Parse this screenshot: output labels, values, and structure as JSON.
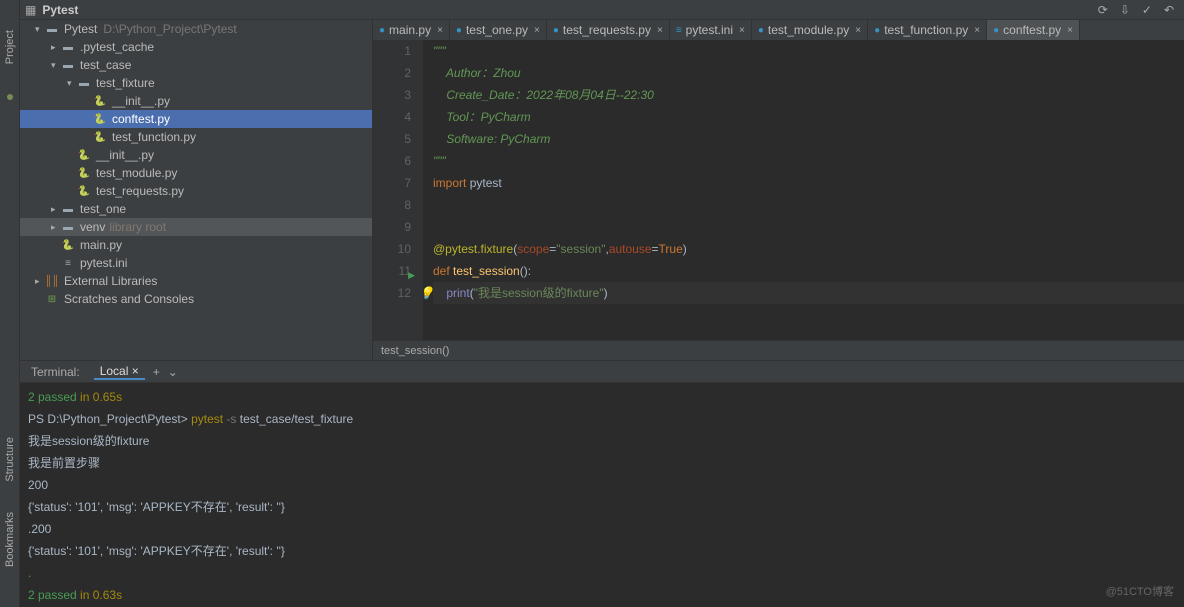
{
  "breadcrumb": {
    "project_name": "Pytest",
    "project_path": "D:\\Python_Project\\Pytest"
  },
  "rail": {
    "project": "Project",
    "structure": "Structure",
    "bookmarks": "Bookmarks"
  },
  "tree": [
    {
      "depth": 0,
      "chevron": "v",
      "icon": "folder-root",
      "label": "Pytest",
      "path": "D:\\Python_Project\\Pytest"
    },
    {
      "depth": 1,
      "chevron": ">",
      "icon": "folder",
      "label": ".pytest_cache"
    },
    {
      "depth": 1,
      "chevron": "v",
      "icon": "folder",
      "label": "test_case"
    },
    {
      "depth": 2,
      "chevron": "v",
      "icon": "folder",
      "label": "test_fixture"
    },
    {
      "depth": 3,
      "chevron": "",
      "icon": "py",
      "label": "__init__.py"
    },
    {
      "depth": 3,
      "chevron": "",
      "icon": "py",
      "label": "conftest.py",
      "selected": true
    },
    {
      "depth": 3,
      "chevron": "",
      "icon": "py",
      "label": "test_function.py"
    },
    {
      "depth": 2,
      "chevron": "",
      "icon": "py",
      "label": "__init__.py"
    },
    {
      "depth": 2,
      "chevron": "",
      "icon": "py",
      "label": "test_module.py"
    },
    {
      "depth": 2,
      "chevron": "",
      "icon": "py",
      "label": "test_requests.py"
    },
    {
      "depth": 1,
      "chevron": ">",
      "icon": "folder",
      "label": "test_one"
    },
    {
      "depth": 1,
      "chevron": ">",
      "icon": "folder",
      "label": "venv",
      "lib": "library root",
      "highlighted": true
    },
    {
      "depth": 1,
      "chevron": "",
      "icon": "py",
      "label": "main.py"
    },
    {
      "depth": 1,
      "chevron": "",
      "icon": "ini",
      "label": "pytest.ini"
    },
    {
      "depth": 0,
      "chevron": ">",
      "icon": "lib",
      "label": "External Libraries"
    },
    {
      "depth": 0,
      "chevron": "",
      "icon": "scratch",
      "label": "Scratches and Consoles"
    }
  ],
  "tabs": [
    {
      "label": "main.py",
      "icon": "py"
    },
    {
      "label": "test_one.py",
      "icon": "py"
    },
    {
      "label": "test_requests.py",
      "icon": "py"
    },
    {
      "label": "pytest.ini",
      "icon": "ini"
    },
    {
      "label": "test_module.py",
      "icon": "py"
    },
    {
      "label": "test_function.py",
      "icon": "py"
    },
    {
      "label": "conftest.py",
      "icon": "py",
      "active": true
    }
  ],
  "code": {
    "lines": [
      {
        "n": 1,
        "style": "comm",
        "text": "\"\"\""
      },
      {
        "n": 2,
        "style": "comm",
        "text": "    Author：Zhou"
      },
      {
        "n": 3,
        "style": "comm",
        "text": "    Create_Date：2022年08月04日--22:30"
      },
      {
        "n": 4,
        "style": "comm",
        "text": "    Tool：PyCharm"
      },
      {
        "n": 5,
        "style": "comm",
        "text": "    Software: PyCharm"
      },
      {
        "n": 6,
        "style": "comm",
        "text": "\"\"\""
      },
      {
        "n": 7,
        "segments": [
          [
            "kw",
            "import "
          ],
          [
            "id",
            "pytest"
          ]
        ]
      },
      {
        "n": 8,
        "text": ""
      },
      {
        "n": 9,
        "text": ""
      },
      {
        "n": 10,
        "segments": [
          [
            "deco",
            "@pytest.fixture"
          ],
          [
            "plain",
            "("
          ],
          [
            "param",
            "scope"
          ],
          [
            "plain",
            "="
          ],
          [
            "str",
            "\"session\""
          ],
          [
            "plain",
            ","
          ],
          [
            "param",
            "autouse"
          ],
          [
            "plain",
            "="
          ],
          [
            "bool",
            "True"
          ],
          [
            "plain",
            ")"
          ]
        ]
      },
      {
        "n": 11,
        "run": true,
        "segments": [
          [
            "kw",
            "def "
          ],
          [
            "fn",
            "test_session"
          ],
          [
            "plain",
            "():"
          ]
        ]
      },
      {
        "n": 12,
        "current": true,
        "bulb": true,
        "segments": [
          [
            "plain",
            "    "
          ],
          [
            "builtin",
            "print"
          ],
          [
            "plain",
            "("
          ],
          [
            "str",
            "\"我是session级的fixture\""
          ],
          [
            "plain",
            ")"
          ]
        ]
      }
    ],
    "breadcrumb": "test_session()"
  },
  "terminal": {
    "title": "Terminal:",
    "tab": "Local",
    "lines": [
      [
        [
          "green",
          "2 passed"
        ],
        [
          "plain",
          " "
        ],
        [
          "yellow",
          "in 0.65s"
        ]
      ],
      [
        [
          "plain",
          "PS D:\\Python_Project\\Pytest> "
        ],
        [
          "yellow",
          "pytest"
        ],
        [
          "gray",
          " -s"
        ],
        [
          "plain",
          " test_case/test_fixture"
        ]
      ],
      [
        [
          "plain",
          "我是session级的fixture"
        ]
      ],
      [
        [
          "plain",
          "我是前置步骤"
        ]
      ],
      [
        [
          "plain",
          "200"
        ]
      ],
      [
        [
          "plain",
          "{'status': '101', 'msg': 'APPKEY不存在', 'result': ''}"
        ]
      ],
      [
        [
          "plain",
          ".200"
        ]
      ],
      [
        [
          "plain",
          "{'status': '101', 'msg': 'APPKEY不存在', 'result': ''}"
        ]
      ],
      [
        [
          "green",
          "."
        ]
      ],
      [
        [
          "green",
          "2 passed"
        ],
        [
          "plain",
          " "
        ],
        [
          "yellow",
          "in 0.63s"
        ]
      ]
    ]
  },
  "watermark": "@51CTO博客"
}
